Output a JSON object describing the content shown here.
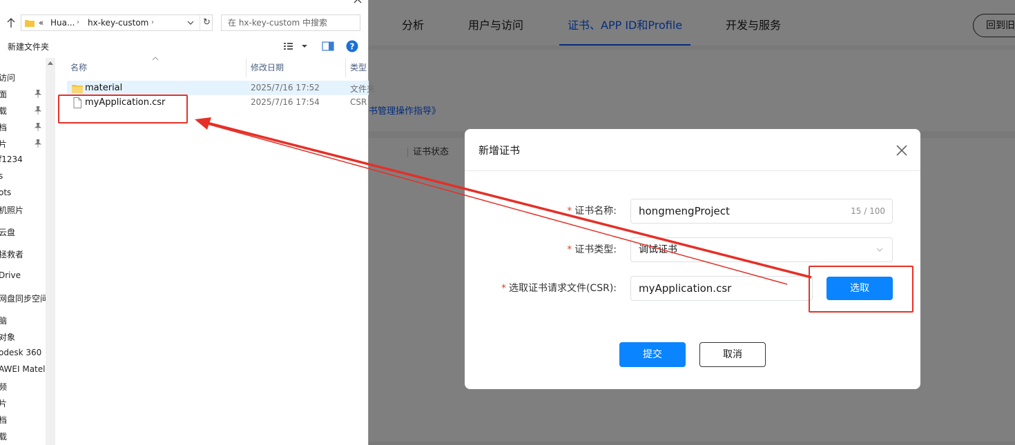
{
  "web": {
    "nav": [
      {
        "label": "分析",
        "active": false
      },
      {
        "label": "用户与访问",
        "active": false
      },
      {
        "label": "证书、APP ID和Profile",
        "active": true
      },
      {
        "label": "开发与服务",
        "active": false
      }
    ],
    "back_button": "回到旧",
    "guide_link": "书管理操作指导》",
    "table_header_status": "证书状态"
  },
  "dialog": {
    "title": "新增证书",
    "required_mark": "*",
    "fields": {
      "name": {
        "label": "证书名称:",
        "value": "hongmengProject",
        "counter": "15 / 100"
      },
      "type": {
        "label": "证书类型:",
        "value": "调试证书"
      },
      "csr": {
        "label": "选取证书请求文件(CSR):",
        "value": "myApplication.csr",
        "select_button": "选取"
      }
    },
    "submit": "提交",
    "cancel": "取消"
  },
  "explorer": {
    "breadcrumb": {
      "lead": "«",
      "segments": [
        "Hua...",
        "hx-key-custom"
      ]
    },
    "search_placeholder": "在 hx-key-custom 中搜索",
    "new_folder": "新建文件夹",
    "columns": {
      "name": "名称",
      "modified": "修改日期",
      "type": "类型"
    },
    "files": [
      {
        "name": "material",
        "modified": "2025/7/16 17:52",
        "type": "文件夹",
        "kind": "folder",
        "selected": true
      },
      {
        "name": "myApplication.csr",
        "modified": "2025/7/16 17:54",
        "type": "CSR",
        "kind": "file",
        "selected": false
      }
    ],
    "nav_items": [
      "访问",
      "面",
      "载",
      "档",
      "片",
      "f1234",
      "s",
      "ots",
      "机照片",
      "云盘",
      "拯救者",
      "Drive",
      "网盘同步空间",
      "脑",
      "对象",
      "odesk 360",
      "AWEI Matel",
      "频",
      "片",
      "档",
      "载"
    ]
  },
  "colors": {
    "accent": "#0a59f7",
    "button": "#0a84ff",
    "annotation": "#e53027",
    "required": "#e84026"
  }
}
